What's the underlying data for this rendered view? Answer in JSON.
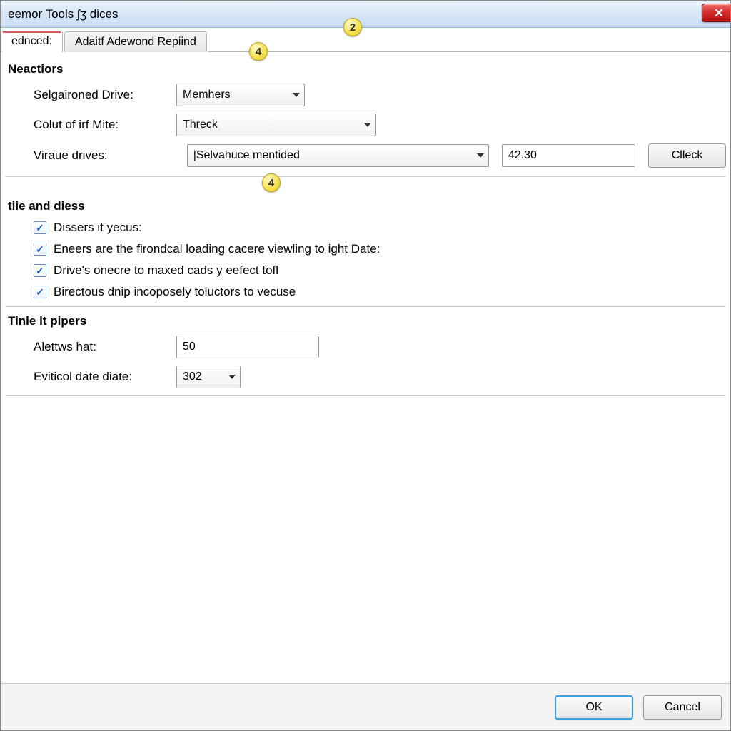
{
  "title": "eemor Tools ʃʒ dices",
  "callouts": {
    "titlebar": "2",
    "tabs": "4",
    "section2": "4"
  },
  "tabs": [
    {
      "label": "ednced:",
      "active": true
    },
    {
      "label": "Adaitf Adewond Repiind",
      "active": false
    }
  ],
  "sections": {
    "s1": {
      "title": "Neactiors",
      "rows": {
        "drive": {
          "label": "Selgaironed Drive:",
          "value": "Memhers"
        },
        "colut": {
          "label": "Colut of irf Mite:",
          "value": "Threck"
        },
        "viraue": {
          "label": "Viraue drives:",
          "value": "|Selvahuce mentided",
          "num": "42.30",
          "btn": "Clleck"
        }
      }
    },
    "s2": {
      "title": "tiie and diess",
      "checks": [
        "Dissers it yecus:",
        "Eneers are the firondcal loading cacere viewling to ight Date:",
        "Drive's onecre to maxed cads y eefect tofl",
        "Birectous dnip incoposely toluctors to vecuse"
      ]
    },
    "s3": {
      "title": "Tinle it pipers",
      "rows": {
        "alet": {
          "label": "Alettws hat:",
          "value": "50"
        },
        "eviti": {
          "label": "Eviticol date diate:",
          "value": "302"
        }
      }
    }
  },
  "footer": {
    "ok": "OK",
    "cancel": "Cancel"
  }
}
